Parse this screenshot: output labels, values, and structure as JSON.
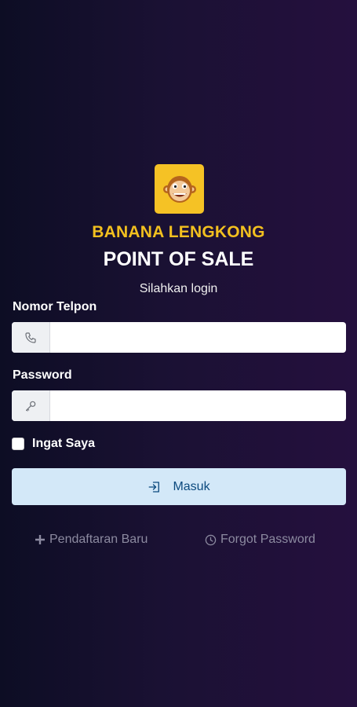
{
  "header": {
    "brand_name": "BANANA LENGKONG",
    "app_title": "POINT OF SALE",
    "prompt": "Silahkan login"
  },
  "form": {
    "phone": {
      "label": "Nomor Telpon",
      "value": "",
      "icon": "phone-icon"
    },
    "password": {
      "label": "Password",
      "value": "",
      "icon": "key-icon"
    },
    "remember_me": {
      "label": "Ingat Saya",
      "checked": false
    },
    "submit": {
      "label": "Masuk",
      "icon": "sign-in-icon"
    }
  },
  "footer": {
    "register": {
      "label": "Pendaftaran Baru",
      "icon": "plus-icon"
    },
    "forgot": {
      "label": "Forgot Password",
      "icon": "clock-icon"
    }
  },
  "colors": {
    "brand_yellow": "#f2c01f",
    "button_bg": "#d3e8f8",
    "button_text": "#0c4a7e",
    "link_muted": "#8c8aa0"
  }
}
